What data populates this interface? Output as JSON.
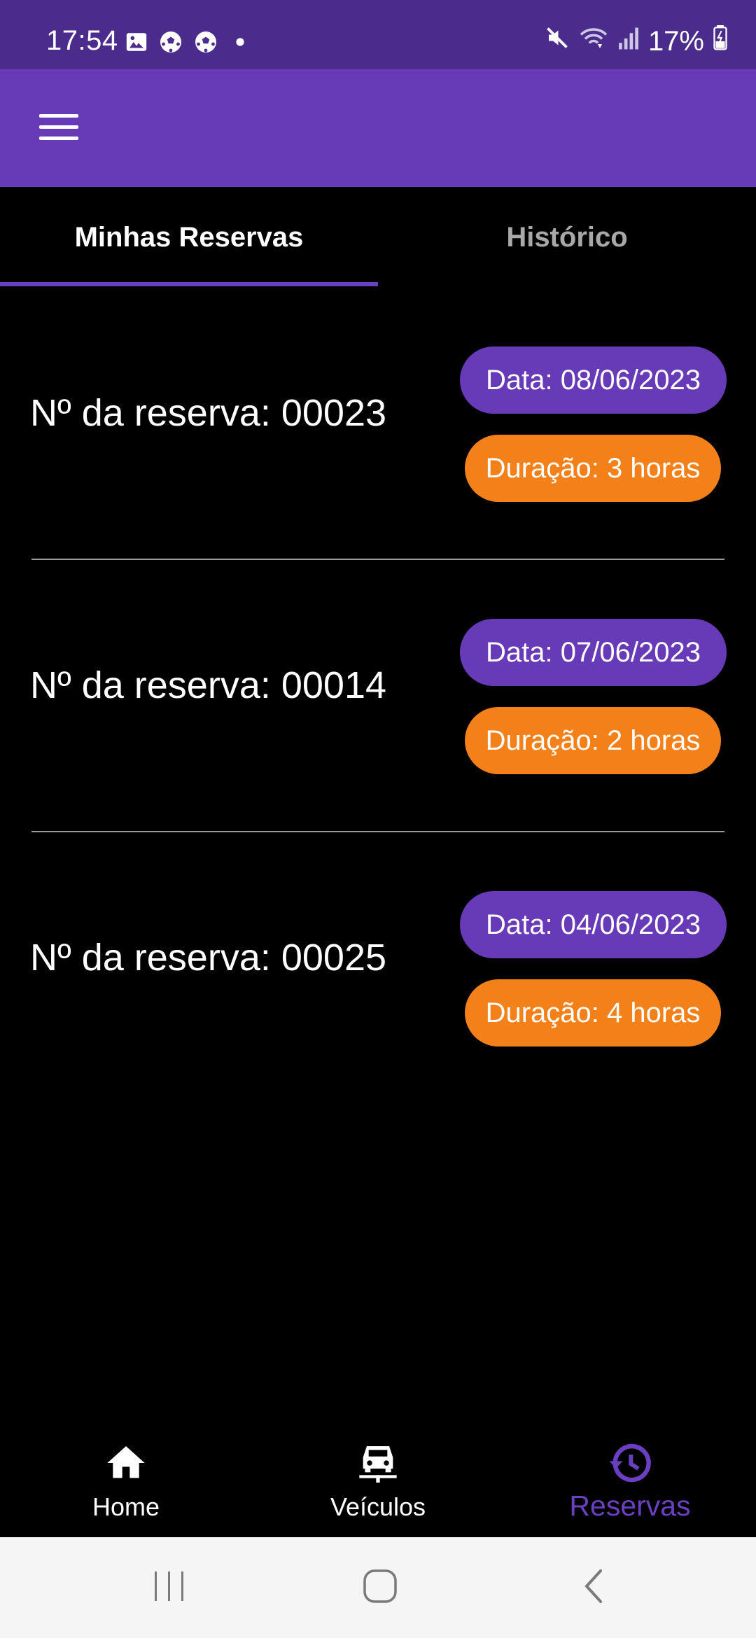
{
  "status_bar": {
    "time": "17:54",
    "notification_icons": [
      "image-icon",
      "soccer-ball-icon",
      "soccer-ball-icon",
      "dot-icon"
    ],
    "battery_percent": "17%",
    "system_icons": [
      "mute-icon",
      "wifi-icon",
      "signal-icon",
      "battery-charging-icon"
    ]
  },
  "app_bar": {
    "menu_icon": "hamburger-menu-icon"
  },
  "tabs": [
    {
      "label": "Minhas Reservas",
      "active": true
    },
    {
      "label": "Histórico",
      "active": false
    }
  ],
  "reservations": [
    {
      "title": "Nº da reserva: 00023",
      "date": "Data: 08/06/2023",
      "duration": "Duração: 3 horas"
    },
    {
      "title": "Nº da reserva: 00014",
      "date": "Data: 07/06/2023",
      "duration": "Duração: 2 horas"
    },
    {
      "title": "Nº da reserva: 00025",
      "date": "Data: 04/06/2023",
      "duration": "Duração: 4 horas"
    }
  ],
  "bottom_nav": [
    {
      "label": "Home",
      "icon": "home-icon",
      "active": false
    },
    {
      "label": "Veículos",
      "icon": "car-icon",
      "active": false
    },
    {
      "label": "Reservas",
      "icon": "history-icon",
      "active": true
    }
  ],
  "system_nav": [
    "recents-icon",
    "home-circle-icon",
    "back-icon"
  ],
  "colors": {
    "status_bar": "#4b2c8c",
    "app_bar": "#673ab7",
    "accent": "#6a3fc1",
    "duration_chip": "#f4801a",
    "background": "#000000"
  }
}
